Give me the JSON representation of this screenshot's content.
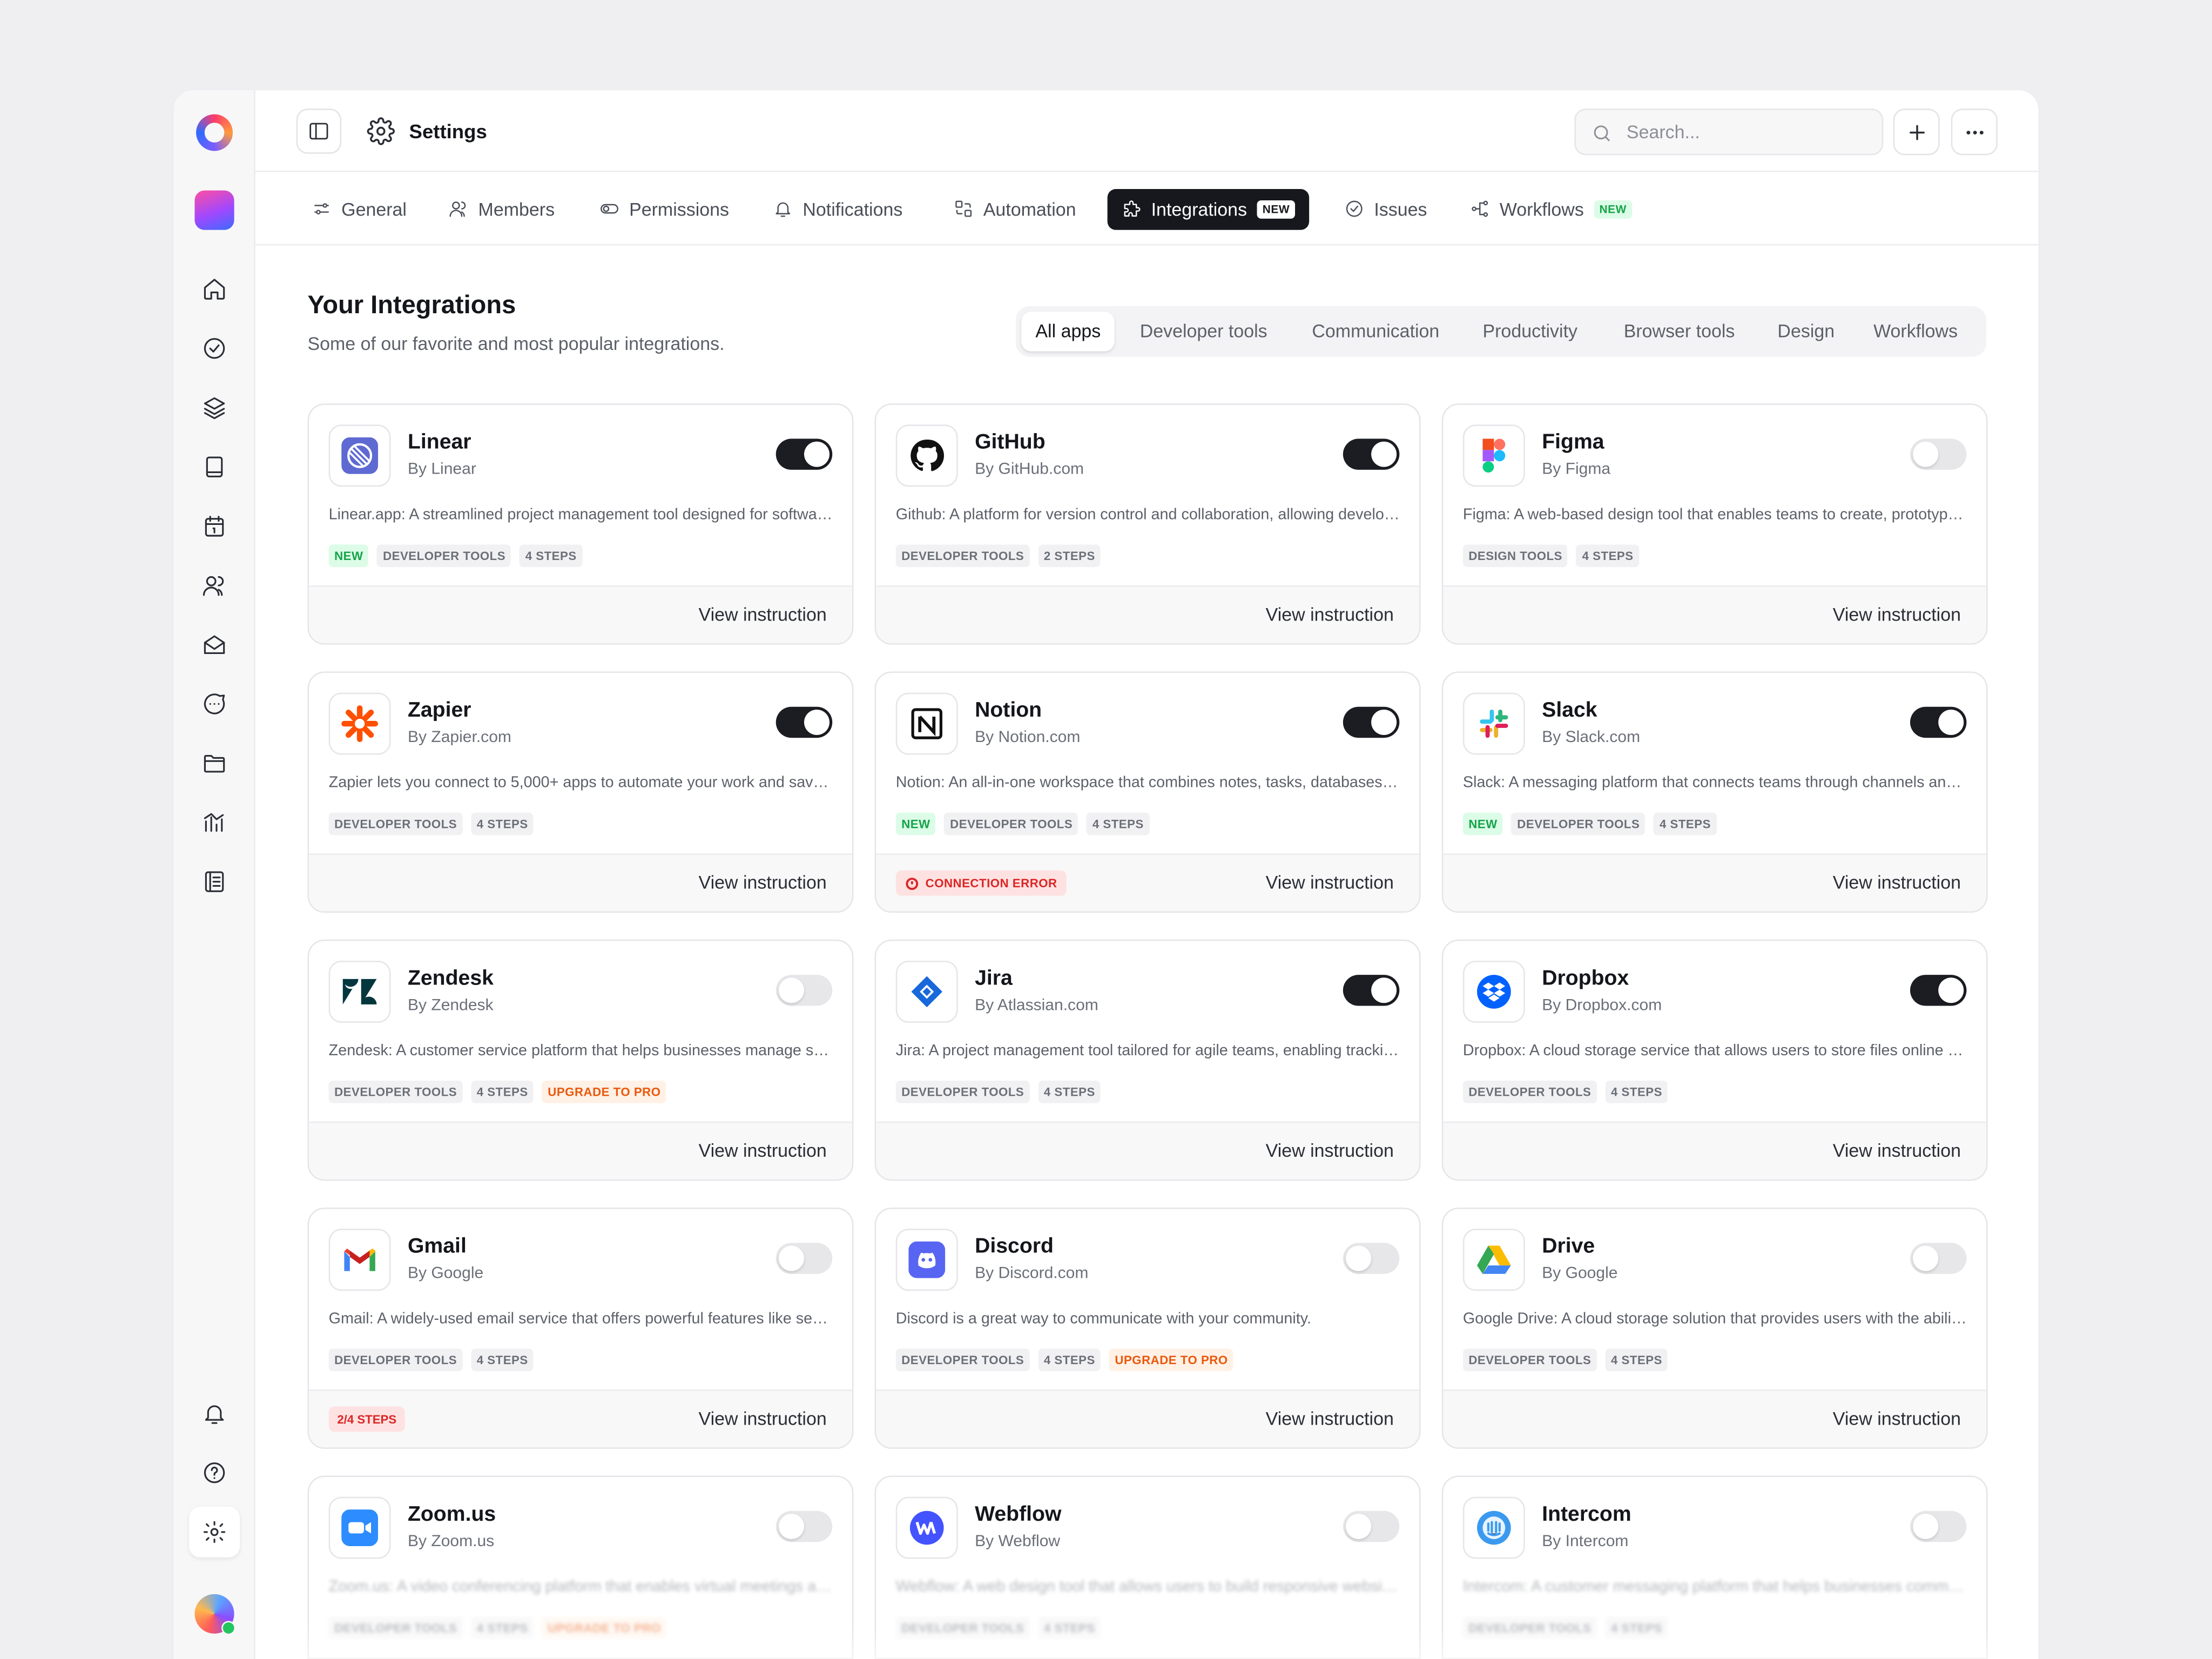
{
  "header": {
    "title": "Settings",
    "search_placeholder": "Search..."
  },
  "tabs": [
    {
      "label": "General",
      "icon": "sliders-icon"
    },
    {
      "label": "Members",
      "icon": "users-icon"
    },
    {
      "label": "Permissions",
      "icon": "toggle-icon"
    },
    {
      "label": "Notifications",
      "icon": "bell-icon"
    },
    {
      "label": "Automation",
      "icon": "automation-icon"
    },
    {
      "label": "Integrations",
      "icon": "puzzle-icon",
      "badge": "NEW",
      "active": true
    },
    {
      "label": "Issues",
      "icon": "check-circle-icon"
    },
    {
      "label": "Workflows",
      "icon": "workflow-icon",
      "badge": "NEW"
    }
  ],
  "main": {
    "title": "Your Integrations",
    "subtitle": "Some of our favorite and most popular integrations.",
    "filters": [
      "All apps",
      "Developer tools",
      "Communication",
      "Productivity",
      "Browser tools",
      "Design",
      "Workflows"
    ],
    "active_filter": "All apps",
    "view_label": "View instruction"
  },
  "integrations": [
    {
      "name": "Linear",
      "by": "By Linear",
      "enabled": true,
      "desc": "Linear.app: A streamlined project management tool designed for software teams.",
      "tags": [
        "NEW",
        "DEVELOPER TOOLS",
        "4 STEPS"
      ],
      "footer_badge": ""
    },
    {
      "name": "GitHub",
      "by": "By GitHub.com",
      "enabled": true,
      "desc": "Github: A platform for version control and collaboration, allowing developers to work together.",
      "tags": [
        "DEVELOPER TOOLS",
        "2 STEPS"
      ],
      "footer_badge": ""
    },
    {
      "name": "Figma",
      "by": "By Figma",
      "enabled": false,
      "desc": "Figma: A web-based design tool that enables teams to create, prototype and collaborate.",
      "tags": [
        "DESIGN TOOLS",
        "4 STEPS"
      ],
      "footer_badge": ""
    },
    {
      "name": "Zapier",
      "by": "By Zapier.com",
      "enabled": true,
      "desc": "Zapier lets you connect to 5,000+ apps to automate your work and save time.",
      "tags": [
        "DEVELOPER TOOLS",
        "4 STEPS"
      ],
      "footer_badge": ""
    },
    {
      "name": "Notion",
      "by": "By Notion.com",
      "enabled": true,
      "desc": "Notion: An all-in-one workspace that combines notes, tasks, databases and wikis.",
      "tags": [
        "NEW",
        "DEVELOPER TOOLS",
        "4 STEPS"
      ],
      "footer_badge": "CONNECTION ERROR"
    },
    {
      "name": "Slack",
      "by": "By Slack.com",
      "enabled": true,
      "desc": "Slack: A messaging platform that connects teams through channels and direct messages.",
      "tags": [
        "NEW",
        "DEVELOPER TOOLS",
        "4 STEPS"
      ],
      "footer_badge": ""
    },
    {
      "name": "Zendesk",
      "by": "By Zendesk",
      "enabled": false,
      "desc": "Zendesk: A customer service platform that helps businesses manage support tickets.",
      "tags": [
        "DEVELOPER TOOLS",
        "4 STEPS",
        "UPGRADE TO PRO"
      ],
      "footer_badge": ""
    },
    {
      "name": "Jira",
      "by": "By Atlassian.com",
      "enabled": true,
      "desc": "Jira: A project management tool tailored for agile teams, enabling tracking of issues.",
      "tags": [
        "DEVELOPER TOOLS",
        "4 STEPS"
      ],
      "footer_badge": ""
    },
    {
      "name": "Dropbox",
      "by": "By Dropbox.com",
      "enabled": true,
      "desc": "Dropbox: A cloud storage service that allows users to store files online and sync them.",
      "tags": [
        "DEVELOPER TOOLS",
        "4 STEPS"
      ],
      "footer_badge": ""
    },
    {
      "name": "Gmail",
      "by": "By Google",
      "enabled": false,
      "desc": "Gmail: A widely-used email service that offers powerful features like search and labels.",
      "tags": [
        "DEVELOPER TOOLS",
        "4 STEPS"
      ],
      "footer_badge": "2/4 STEPS"
    },
    {
      "name": "Discord",
      "by": "By Discord.com",
      "enabled": false,
      "desc": "Discord is a great way to communicate with your community.",
      "tags": [
        "DEVELOPER TOOLS",
        "4 STEPS",
        "UPGRADE TO PRO"
      ],
      "footer_badge": ""
    },
    {
      "name": "Drive",
      "by": "By Google",
      "enabled": false,
      "desc": "Google Drive: A cloud storage solution that provides users with the ability to store files.",
      "tags": [
        "DEVELOPER TOOLS",
        "4 STEPS"
      ],
      "footer_badge": ""
    },
    {
      "name": "Zoom.us",
      "by": "By Zoom.us",
      "enabled": false,
      "desc": "Zoom.us: A video conferencing platform that enables virtual meetings and webinars.",
      "tags": [
        "DEVELOPER TOOLS",
        "4 STEPS",
        "UPGRADE TO PRO"
      ],
      "footer_badge": ""
    },
    {
      "name": "Webflow",
      "by": "By Webflow",
      "enabled": false,
      "desc": "Webflow: A web design tool that allows users to build responsive websites visually.",
      "tags": [
        "DEVELOPER TOOLS",
        "4 STEPS"
      ],
      "footer_badge": ""
    },
    {
      "name": "Intercom",
      "by": "By Intercom",
      "enabled": false,
      "desc": "Intercom: A customer messaging platform that helps businesses communicate with customers.",
      "tags": [
        "DEVELOPER TOOLS",
        "4 STEPS"
      ],
      "footer_badge": ""
    }
  ],
  "sidebar": {
    "icons": [
      "home-icon",
      "check-circle-icon",
      "layers-icon",
      "book-icon",
      "calendar-icon",
      "users-icon",
      "inbox-icon",
      "chat-icon",
      "folder-icon",
      "chart-icon",
      "document-icon"
    ],
    "bottom_icons": [
      "bell-icon",
      "help-icon",
      "gear-icon"
    ]
  },
  "colors": {
    "accent_dark": "#16181d",
    "new_green": "#16a34a",
    "pro_orange": "#ea580c",
    "error_red": "#dc2626"
  }
}
